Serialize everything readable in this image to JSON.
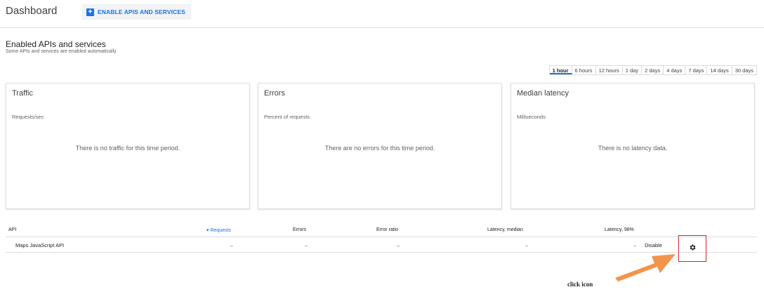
{
  "header": {
    "title": "Dashboard",
    "enable_button_icon": "plus-icon",
    "enable_button_label": "ENABLE APIS AND SERVICES"
  },
  "section": {
    "title": "Enabled APIs and services",
    "subtitle": "Some APIs and services are enabled automatically"
  },
  "time_range": {
    "options": [
      "1 hour",
      "6 hours",
      "12 hours",
      "1 day",
      "2 days",
      "4 days",
      "7 days",
      "14 days",
      "30 days"
    ],
    "selected": "1 hour"
  },
  "cards": [
    {
      "title": "Traffic",
      "subtitle": "Requests/sec",
      "empty_text": "There is no traffic for this time period."
    },
    {
      "title": "Errors",
      "subtitle": "Percent of requests",
      "empty_text": "There are no errors for this time period."
    },
    {
      "title": "Median latency",
      "subtitle": "Milliseconds",
      "empty_text": "There is no latency data."
    }
  ],
  "table": {
    "columns": [
      "API",
      "Requests",
      "Errors",
      "Error ratio",
      "Latency, median",
      "Latency, 98%"
    ],
    "sort_icon": "sort-down-icon",
    "rows": [
      {
        "api": "Maps JavaScript API",
        "requests": "–",
        "errors": "–",
        "error_ratio": "–",
        "latency_median": "–",
        "latency_98": "–",
        "action": "Disable",
        "settings_icon": "gear-icon"
      }
    ]
  },
  "annotation": {
    "text": "click icon",
    "highlight_color": "#c62828",
    "arrow_color": "#f28b3c"
  },
  "colors": {
    "accent": "#1a73e8",
    "border": "#dadce0"
  }
}
